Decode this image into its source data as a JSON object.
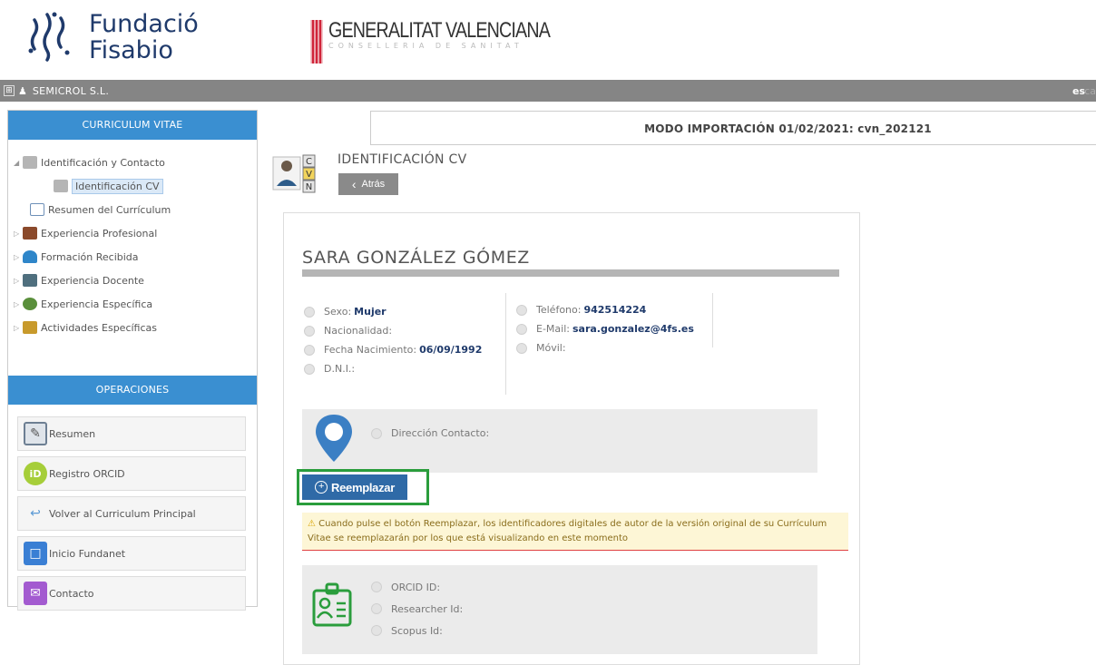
{
  "header": {
    "fisabio_line1": "Fundació",
    "fisabio_line2": "Fisabio",
    "gv_title": "GENERALITAT VALENCIANA",
    "gv_subtitle": "CONSELLERIA DE SANITAT"
  },
  "topbar": {
    "expand_icon": "⊞",
    "company": "SEMICROL S.L.",
    "lang_selected": "es",
    "lang_other": "ca"
  },
  "sidebar": {
    "cv_header": "CURRICULUM VITAE",
    "tree": [
      {
        "label": "Identificación y Contacto",
        "arrow": "◢",
        "icon_color": "#b5b5b5",
        "icon": "id-card-icon"
      },
      {
        "label": "Identificación CV",
        "selected": true,
        "icon_color": "#b5b5b5",
        "icon": "cv-icon"
      },
      {
        "label": "Resumen del Currículum",
        "icon_color": "#6e90b8",
        "icon": "document-icon"
      },
      {
        "label": "Experiencia Profesional",
        "arrow": "▷",
        "icon_color": "#8b4a2b",
        "icon": "briefcase-icon"
      },
      {
        "label": "Formación Recibida",
        "arrow": "▷",
        "icon_color": "#2f86c9",
        "icon": "training-icon"
      },
      {
        "label": "Experiencia Docente",
        "arrow": "▷",
        "icon_color": "#4f6f7e",
        "icon": "teaching-icon"
      },
      {
        "label": "Experiencia Específica",
        "arrow": "▷",
        "icon_color": "#5a8f3b",
        "icon": "specific-icon"
      },
      {
        "label": "Actividades Específicas",
        "arrow": "▷",
        "icon_color": "#c89a2c",
        "icon": "activities-icon"
      }
    ],
    "ops_header": "OPERACIONES",
    "operations": [
      {
        "label": "Resumen",
        "icon": "clipboard-icon",
        "icon_color": "#6d7f93"
      },
      {
        "label": "Registro ORCID",
        "icon": "orcid-icon",
        "icon_color": "#a6ce39"
      },
      {
        "label": "Volver al Curriculum Principal",
        "icon": "return-icon",
        "icon_color": "#5b9ad5"
      },
      {
        "label": "Inicio Fundanet",
        "icon": "home-screen-icon",
        "icon_color": "#3a7fd4"
      },
      {
        "label": "Contacto",
        "icon": "envelope-icon",
        "icon_color": "#a35bd0"
      }
    ]
  },
  "main": {
    "mode_banner": "MODO IMPORTACIÓN 01/02/2021: cvn_202121",
    "page_title": "IDENTIFICACIÓN CV",
    "back_label": "Atrás",
    "person_name": "SARA GONZÁLEZ GÓMEZ",
    "left_info": [
      {
        "label": "Sexo:",
        "value": "Mujer"
      },
      {
        "label": "Nacionalidad:",
        "value": ""
      },
      {
        "label": "Fecha Nacimiento:",
        "value": "06/09/1992"
      },
      {
        "label": "D.N.I.:",
        "value": ""
      }
    ],
    "right_info": [
      {
        "label": "Teléfono:",
        "value": "942514224"
      },
      {
        "label": "E-Mail:",
        "value": "sara.gonzalez@4fs.es"
      },
      {
        "label": "Móvil:",
        "value": ""
      }
    ],
    "address_label": "Dirección Contacto:",
    "replace_label": "Reemplazar",
    "warning_text": "Cuando pulse el botón Reemplazar, los identificadores digitales de autor de la versión original de su Currículum Vitae se reemplazarán por los que está visualizando en este momento",
    "ids": [
      {
        "label": "ORCID ID:"
      },
      {
        "label": "Researcher Id:"
      },
      {
        "label": "Scopus Id:"
      }
    ]
  },
  "colors": {
    "accent_blue": "#3a8fd1",
    "replace_button": "#2f6aa7",
    "highlight_frame": "#2a9d3c",
    "topbar": "#858585"
  }
}
